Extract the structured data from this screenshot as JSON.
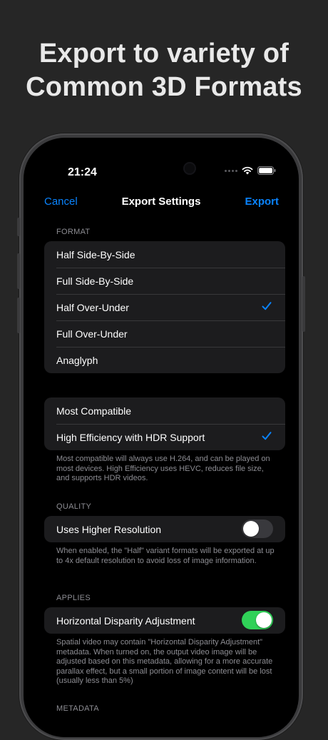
{
  "headline": {
    "line1": "Export to variety of",
    "line2": "Common 3D Formats"
  },
  "status_bar": {
    "time": "21:24",
    "icons": [
      "signal-dots-icon",
      "wifi-icon",
      "battery-icon"
    ]
  },
  "nav": {
    "cancel_label": "Cancel",
    "title": "Export Settings",
    "export_label": "Export"
  },
  "format": {
    "header": "FORMAT",
    "options": [
      {
        "label": "Half Side-By-Side",
        "selected": false
      },
      {
        "label": "Full Side-By-Side",
        "selected": false
      },
      {
        "label": "Half Over-Under",
        "selected": true
      },
      {
        "label": "Full Over-Under",
        "selected": false
      },
      {
        "label": "Anaglyph",
        "selected": false
      }
    ]
  },
  "encoding": {
    "options": [
      {
        "label": "Most Compatible",
        "selected": false
      },
      {
        "label": "High Efficiency with HDR Support",
        "selected": true
      }
    ],
    "footnote": "Most compatible will always use H.264, and can be played on most devices. High Efficiency uses HEVC, reduces file size, and supports HDR videos."
  },
  "quality": {
    "header": "QUALITY",
    "label": "Uses Higher Resolution",
    "enabled": false,
    "footnote": "When enabled, the \"Half\" variant formats will be exported at up to 4x default resolution to avoid loss of image information."
  },
  "applies": {
    "header": "APPLIES",
    "label": "Horizontal Disparity Adjustment",
    "enabled": true,
    "footnote": "Spatial video may contain \"Horizontal Disparity Adjustment\" metadata. When turned on, the output video image will be adjusted based on this metadata, allowing for a more accurate parallax effect, but a small portion of image content will be lost (usually less than 5%)"
  },
  "metadata": {
    "header": "METADATA"
  },
  "colors": {
    "accent": "#0a84ff",
    "toggle_on": "#30d158",
    "toggle_off": "#39393d",
    "cell_background": "#1c1c1e"
  }
}
